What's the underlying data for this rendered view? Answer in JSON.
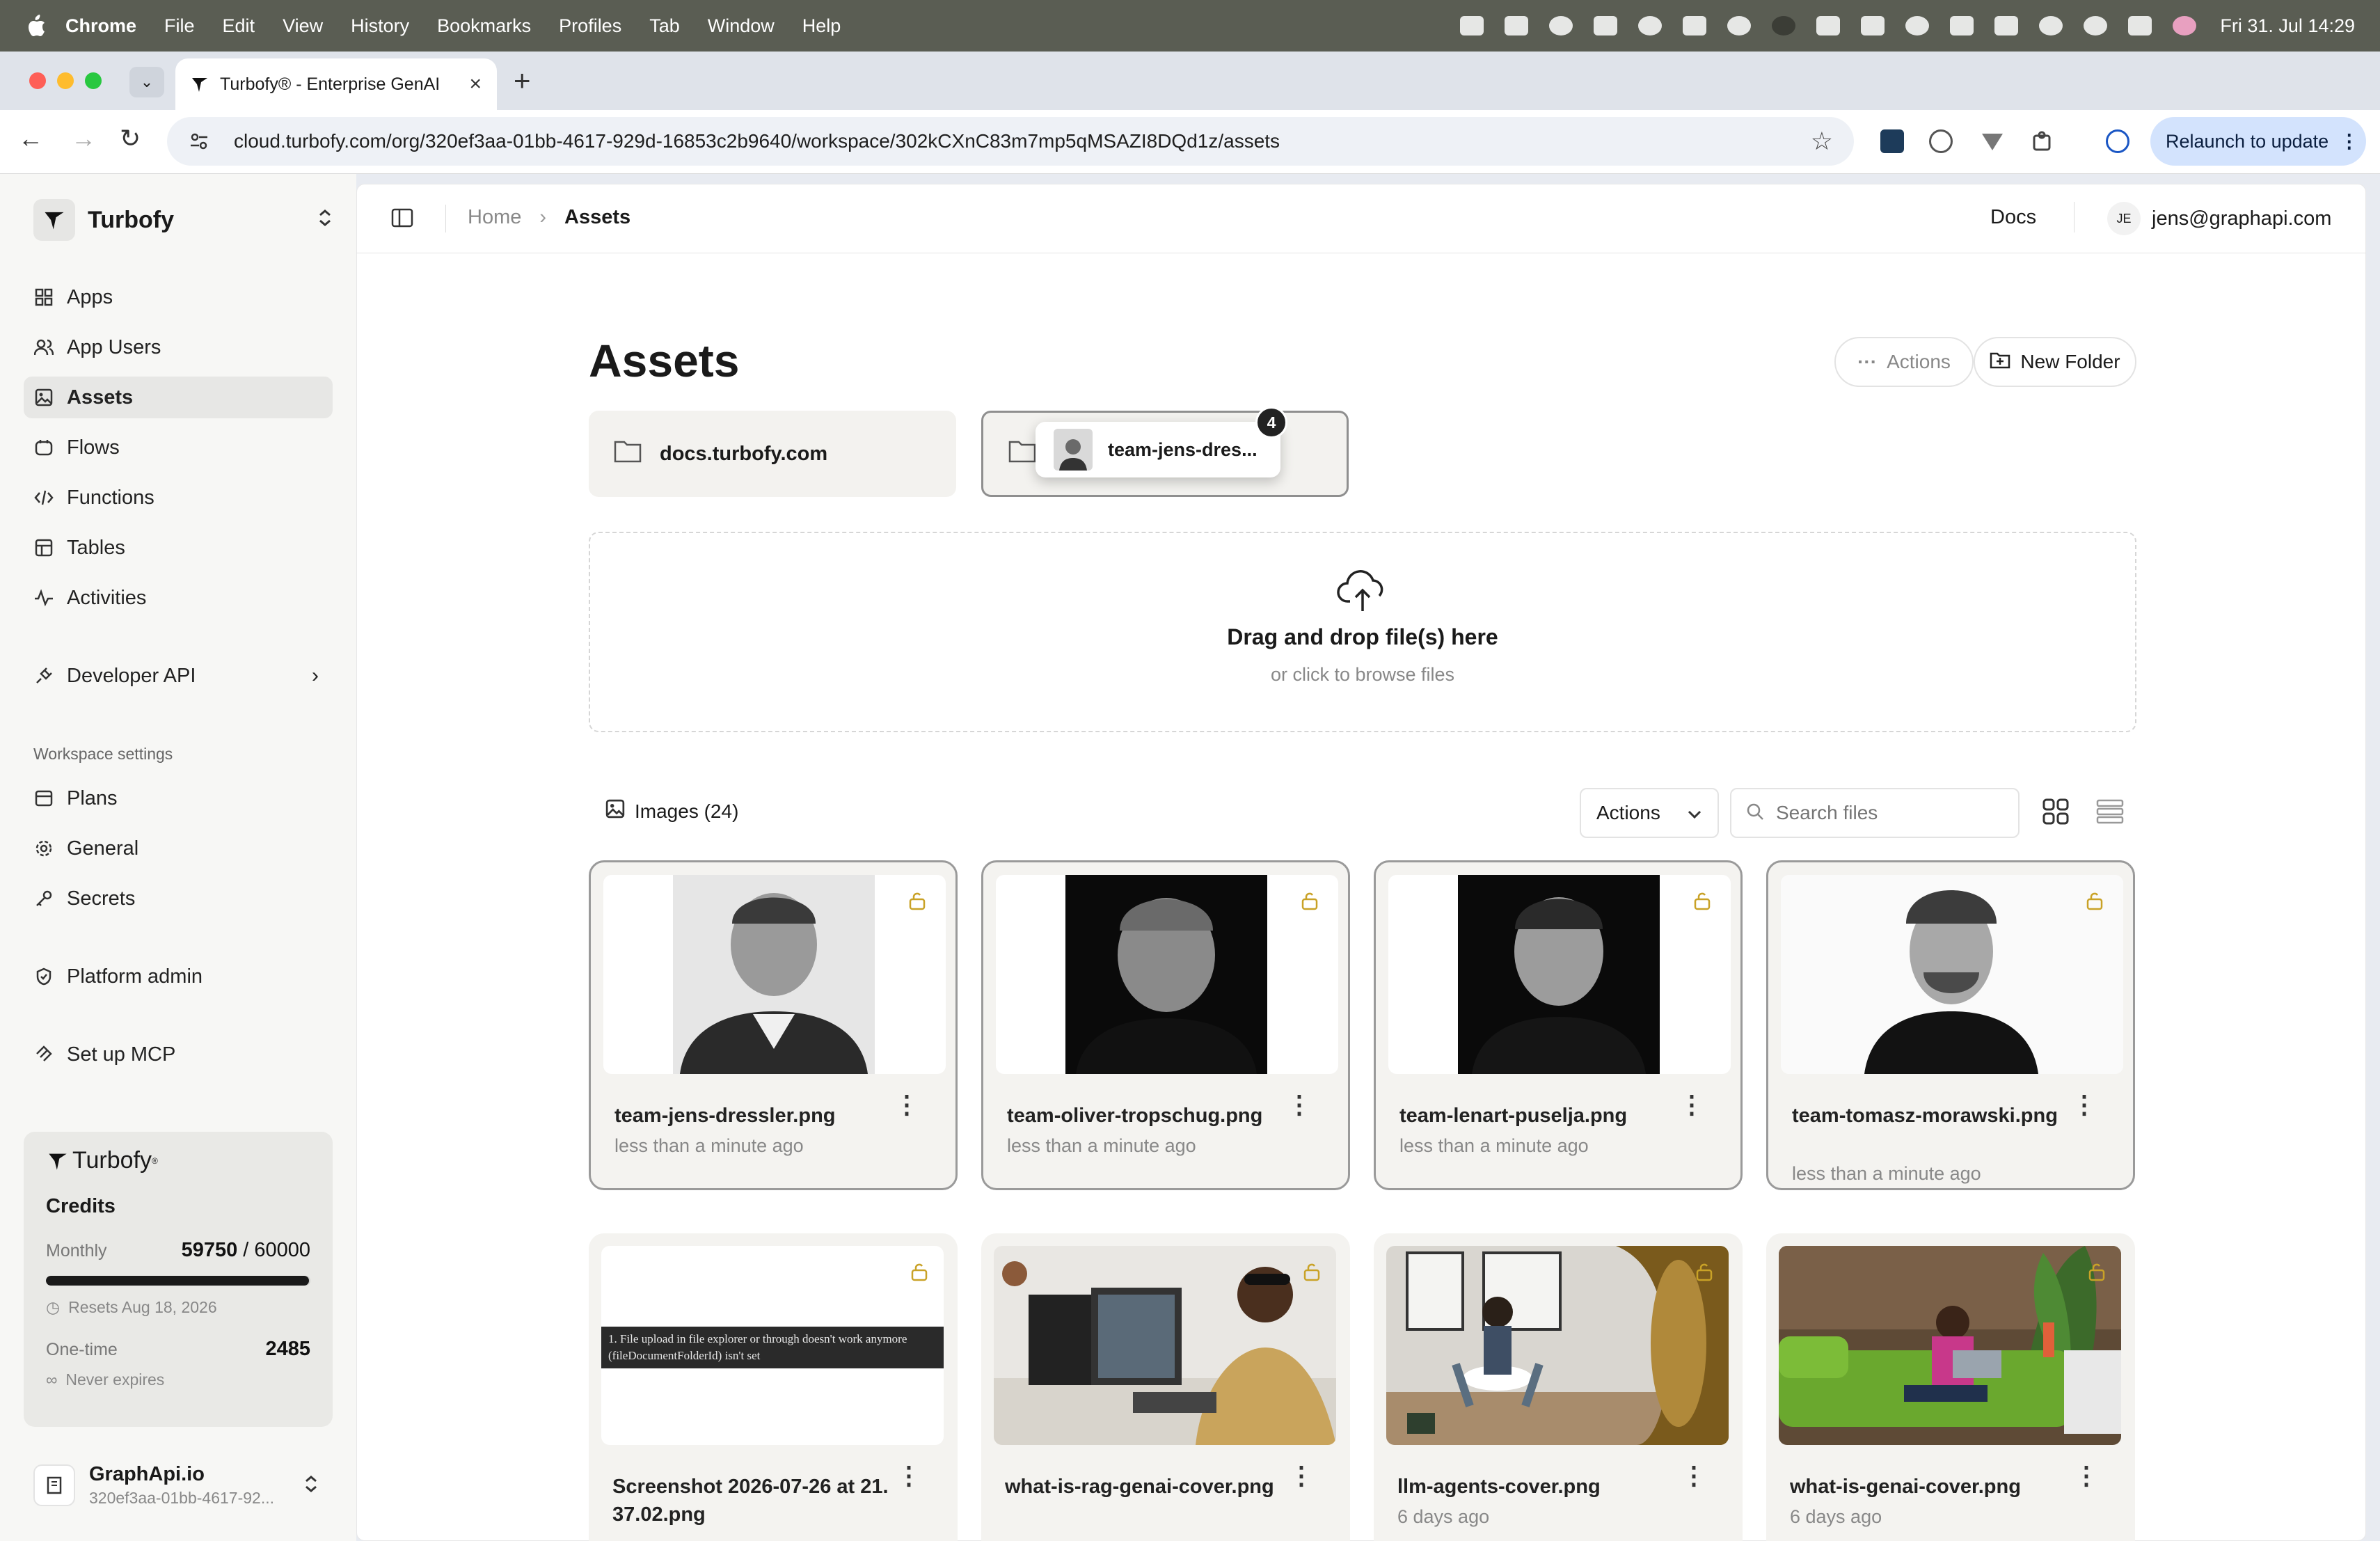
{
  "menubar": {
    "app": "Chrome",
    "items": [
      "File",
      "Edit",
      "View",
      "History",
      "Bookmarks",
      "Profiles",
      "Tab",
      "Window",
      "Help"
    ],
    "clock": "Fri 31. Jul  14:29"
  },
  "browser": {
    "tab_title": "Turbofy® - Enterprise GenAI",
    "url": "cloud.turbofy.com/org/320ef3aa-01bb-4617-929d-16853c2b9640/workspace/302kCXnC83m7mp5qMSAZI8DQd1z/assets",
    "relaunch_label": "Relaunch to update"
  },
  "sidebar": {
    "brand": "Turbofy",
    "nav": [
      {
        "label": "Apps",
        "icon": "grid-icon"
      },
      {
        "label": "App Users",
        "icon": "users-icon"
      },
      {
        "label": "Assets",
        "icon": "image-icon"
      },
      {
        "label": "Flows",
        "icon": "flow-icon"
      },
      {
        "label": "Functions",
        "icon": "code-icon"
      },
      {
        "label": "Tables",
        "icon": "table-icon"
      },
      {
        "label": "Activities",
        "icon": "activity-icon"
      }
    ],
    "developer_api": "Developer API",
    "workspace_settings_title": "Workspace settings",
    "settings": [
      {
        "label": "Plans",
        "icon": "layers-icon"
      },
      {
        "label": "General",
        "icon": "gear-icon"
      },
      {
        "label": "Secrets",
        "icon": "key-icon"
      }
    ],
    "platform_admin": "Platform admin",
    "setup_mcp": "Set up MCP",
    "credits": {
      "logo_text": "Turbofy",
      "title": "Credits",
      "monthly_label": "Monthly",
      "monthly_used": "59750",
      "monthly_total": "/ 60000",
      "monthly_fraction": 0.9958,
      "resets": "Resets Aug 18, 2026",
      "onetime_label": "One-time",
      "onetime_value": "2485",
      "never_expires": "Never expires"
    },
    "workspace": {
      "name": "GraphApi.io",
      "id": "320ef3aa-01bb-4617-92..."
    }
  },
  "header": {
    "breadcrumb_home": "Home",
    "breadcrumb_current": "Assets",
    "docs": "Docs",
    "user_initials": "JE",
    "user_email": "jens@graphapi.com"
  },
  "page": {
    "title": "Assets",
    "actions_label": "Actions",
    "new_folder_label": "New Folder",
    "folders": [
      {
        "name": "docs.turbofy.com"
      },
      {
        "drag_label": "team-jens-dres...",
        "badge": "4"
      }
    ],
    "dropzone": {
      "title": "Drag and drop file(s) here",
      "subtitle": "or click to browse files"
    },
    "images_label": "Images (24)",
    "actions_select": "Actions",
    "search_placeholder": "Search files",
    "files": [
      {
        "name": "team-jens-dressler.png",
        "date": "less than a minute ago",
        "thumb": "portrait-gray"
      },
      {
        "name": "team-oliver-tropschug.png",
        "date": "less than a minute ago",
        "thumb": "portrait-black"
      },
      {
        "name": "team-lenart-puselja.png",
        "date": "less than a minute ago",
        "thumb": "portrait-black"
      },
      {
        "name": "team-tomasz-morawski.png",
        "date": "less than a minute ago",
        "thumb": "portrait-white"
      },
      {
        "name": "Screenshot 2026-07-26 at 21.37.02.png",
        "date": "",
        "thumb": "screenshot",
        "screenshot_text": "1.   File upload in file explorer or through doesn't work anymore (fileDocumentFolderId) isn't set"
      },
      {
        "name": "what-is-rag-genai-cover.png",
        "date": "",
        "thumb": "office"
      },
      {
        "name": "llm-agents-cover.png",
        "date": "6 days ago",
        "thumb": "cafe"
      },
      {
        "name": "what-is-genai-cover.png",
        "date": "6 days ago",
        "thumb": "sofa"
      }
    ]
  },
  "colors": {
    "sidebar_bg": "#f7f7f5",
    "active_item": "#e7e7e5",
    "lock_gold": "#c9a227",
    "relaunch_bg": "#d3e3fd",
    "menubar_bg": "#5a5d53"
  }
}
